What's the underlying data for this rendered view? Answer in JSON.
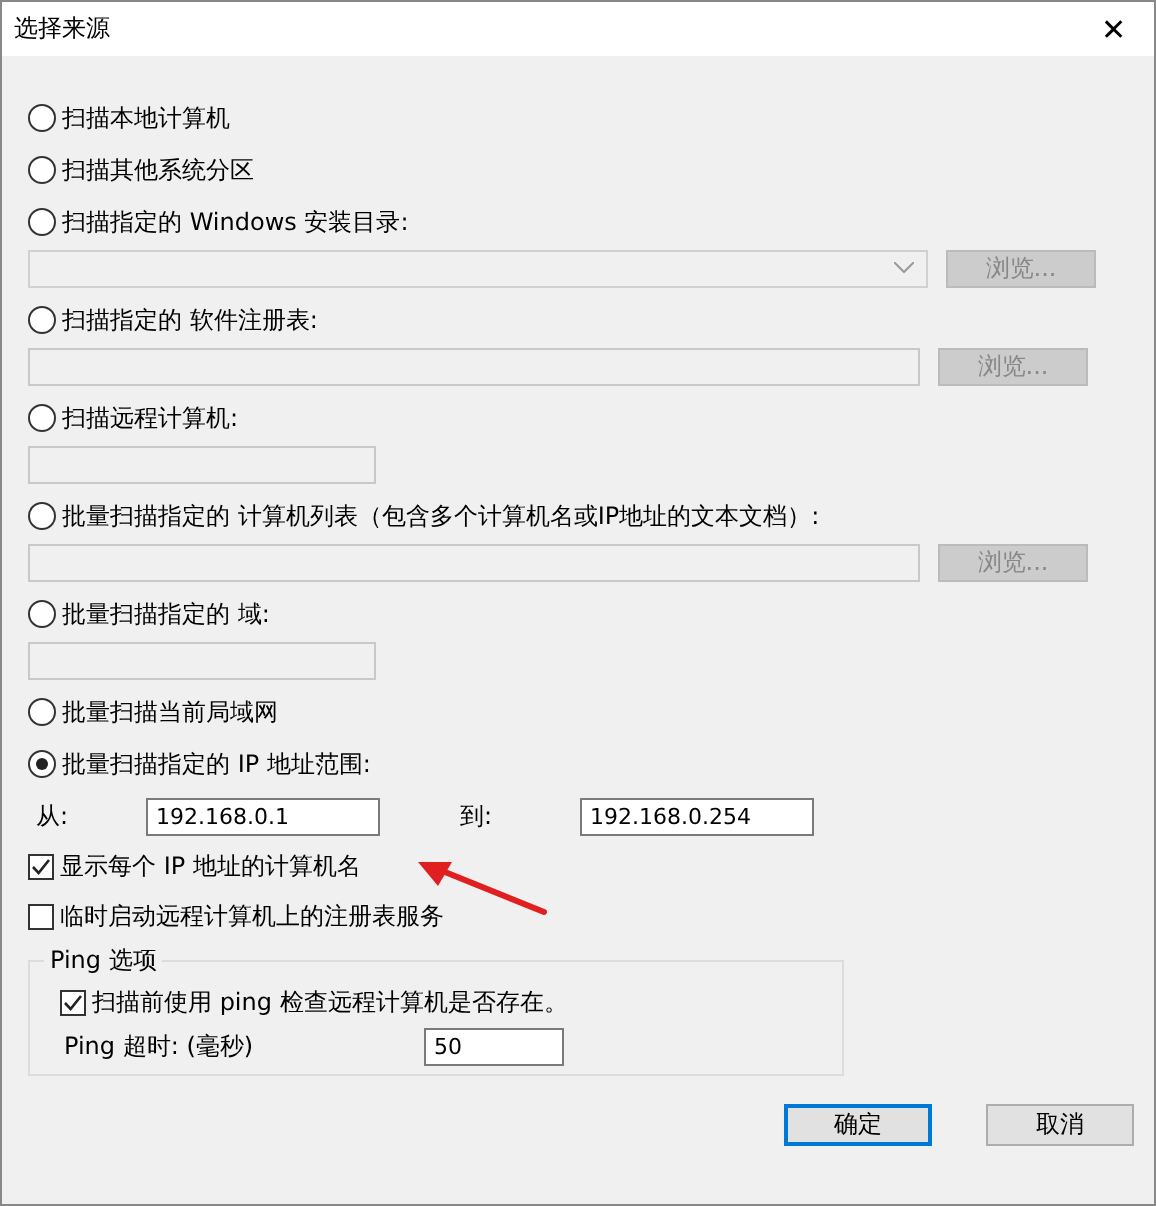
{
  "window": {
    "title": "选择来源",
    "close": "✕"
  },
  "options": [
    {
      "label": "扫描本地计算机",
      "selected": false
    },
    {
      "label": "扫描其他系统分区",
      "selected": false
    },
    {
      "label": "扫描指定的 Windows 安装目录:",
      "selected": false,
      "field": {
        "kind": "combo",
        "disabled": true
      },
      "browse": {
        "label": "浏览...",
        "disabled": true
      }
    },
    {
      "label": "扫描指定的 软件注册表:",
      "selected": false,
      "field": {
        "kind": "text",
        "disabled": true
      },
      "browse": {
        "label": "浏览...",
        "disabled": true
      }
    },
    {
      "label": "扫描远程计算机:",
      "selected": false,
      "field": {
        "kind": "text",
        "disabled": true
      }
    },
    {
      "label": "批量扫描指定的 计算机列表（包含多个计算机名或IP地址的文本文档）:",
      "selected": false,
      "field": {
        "kind": "text",
        "disabled": true
      },
      "browse": {
        "label": "浏览...",
        "disabled": true
      }
    },
    {
      "label": "批量扫描指定的 域:",
      "selected": false,
      "field": {
        "kind": "text",
        "disabled": true
      }
    },
    {
      "label": "批量扫描当前局域网",
      "selected": false
    },
    {
      "label": "批量扫描指定的 IP 地址范围:",
      "selected": true
    }
  ],
  "range": {
    "from_label": "从:",
    "from": "192.168.0.1",
    "to_label": "到:",
    "to": "192.168.0.254"
  },
  "checks": [
    {
      "label": "显示每个 IP 地址的计算机名",
      "checked": true
    },
    {
      "label": "临时启动远程计算机上的注册表服务",
      "checked": false
    }
  ],
  "ping": {
    "legend": "Ping 选项",
    "check": {
      "label": "扫描前使用 ping 检查远程计算机是否存在。",
      "checked": true
    },
    "timeout_label": "Ping 超时: (毫秒)",
    "timeout": "50"
  },
  "buttons": [
    {
      "label": "确定",
      "default": true
    },
    {
      "label": "取消",
      "default": false
    }
  ]
}
